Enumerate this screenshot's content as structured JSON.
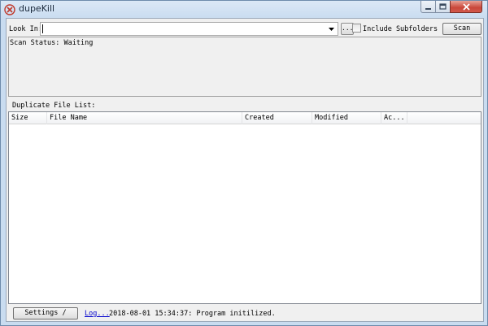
{
  "window": {
    "title": "dupeKill"
  },
  "toolbar": {
    "look_in_label": "Look In:",
    "path_value": "",
    "browse_label": "...",
    "include_subfolders_label": "Include Subfolders",
    "include_subfolders_checked": false,
    "scan_label": "Scan"
  },
  "status": {
    "text": "Scan Status: Waiting"
  },
  "duplicate_list": {
    "label": "Duplicate File List:",
    "columns": [
      "Size",
      "File Name",
      "Created",
      "Modified",
      "Ac..."
    ],
    "rows": []
  },
  "footer": {
    "settings_label": "Settings /",
    "log_link_label": "Log...",
    "log_message": "2018-08-01 15:34:37: Program initilized."
  },
  "icons": {
    "app": "dupekill-x-icon",
    "minimize": "minimize-icon",
    "maximize": "maximize-icon",
    "close": "close-icon",
    "combo": "chevron-down-icon"
  },
  "colors": {
    "title_bar": "#c9dcf0",
    "close_button": "#c9473a",
    "client_bg": "#f0f0f0",
    "link": "#0000cc"
  }
}
